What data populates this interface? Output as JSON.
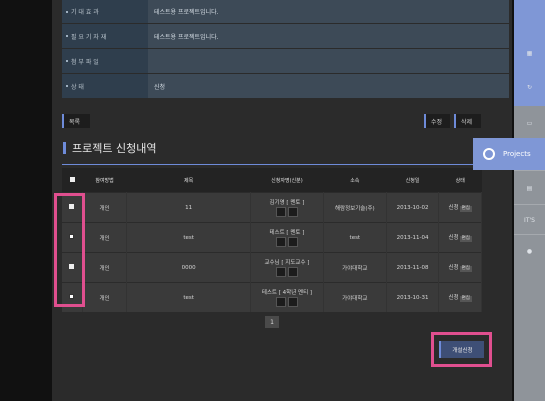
{
  "info": [
    {
      "label": "기 대 효 과",
      "value": "테스트용 프로젝트입니다."
    },
    {
      "label": "필 요 기 자 재",
      "value": "테스트용 프로젝트입니다."
    },
    {
      "label": "첨 부 파 일",
      "value": ""
    },
    {
      "label": "상 태",
      "value": "신청"
    }
  ],
  "buttons": {
    "list": "목록",
    "edit": "수정",
    "delete": "삭제"
  },
  "section_title": "프로젝트 신청내역",
  "table": {
    "headers": [
      "",
      "참여방법",
      "제목",
      "신청자명(신분)",
      "소속",
      "신청일",
      "상태"
    ],
    "rows": [
      {
        "method": "개인",
        "title": "11",
        "applicant": "김기영 [ 멘토 ]",
        "org": "해람정보기술(주)",
        "date": "2013-10-02",
        "status": "신청",
        "edit": "편집",
        "checked": false
      },
      {
        "method": "개인",
        "title": "test",
        "applicant": "테스트 [ 멘토 ]",
        "org": "test",
        "date": "2013-11-04",
        "status": "신청",
        "edit": "편집",
        "checked": true
      },
      {
        "method": "개인",
        "title": "0000",
        "applicant": "교수님 [ 지도교수 ]",
        "org": "가야대학교",
        "date": "2013-11-08",
        "status": "신청",
        "edit": "편집",
        "checked": false
      },
      {
        "method": "개인",
        "title": "test",
        "applicant": "테스트 [ 4학년 멘티 ]",
        "org": "가야대학교",
        "date": "2013-10-31",
        "status": "신청",
        "edit": "편집",
        "checked": true
      }
    ]
  },
  "pagination": {
    "current": "1"
  },
  "apply_button": "개설신청",
  "sidebar": {
    "projects": "Projects",
    "its": "IT'S"
  }
}
